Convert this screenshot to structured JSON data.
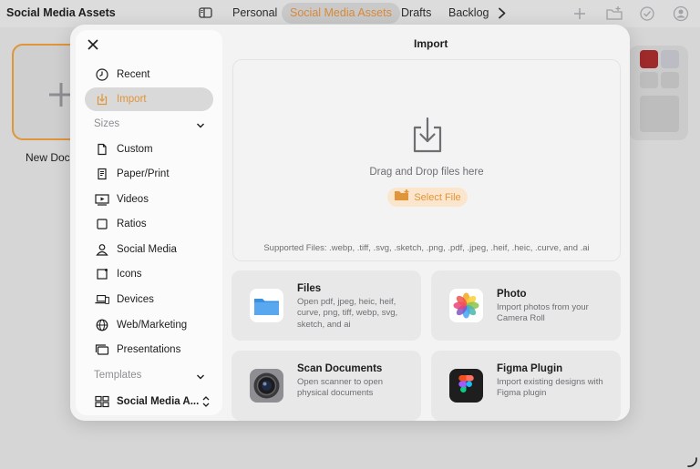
{
  "app": {
    "title": "Social Media Assets"
  },
  "tabs": [
    {
      "label": "Personal"
    },
    {
      "label": "Social Media Assets"
    },
    {
      "label": "Drafts"
    },
    {
      "label": "Backlog"
    }
  ],
  "toolbar": {
    "icons": [
      "sidebar-icon",
      "chevron-right-icon",
      "plus-icon",
      "folder-plus-icon",
      "checkmark-circle-icon",
      "account-icon"
    ]
  },
  "background": {
    "new_document_label": "New Docu"
  },
  "modal": {
    "title": "Import",
    "sidebar": {
      "items": [
        {
          "label": "Recent",
          "icon": "clock-icon"
        },
        {
          "label": "Import",
          "icon": "import-icon"
        }
      ],
      "sizes_header": "Sizes",
      "sizes": [
        {
          "label": "Custom",
          "icon": "document-icon"
        },
        {
          "label": "Paper/Print",
          "icon": "paper-icon"
        },
        {
          "label": "Videos",
          "icon": "video-icon"
        },
        {
          "label": "Ratios",
          "icon": "square-icon"
        },
        {
          "label": "Social Media",
          "icon": "person-icon"
        },
        {
          "label": "Icons",
          "icon": "icon-frame-icon"
        },
        {
          "label": "Devices",
          "icon": "devices-icon"
        },
        {
          "label": "Web/Marketing",
          "icon": "globe-icon"
        },
        {
          "label": "Presentations",
          "icon": "presentation-icon"
        }
      ],
      "templates_header": "Templates",
      "templates_selected": "Social Media A..."
    },
    "drop_zone": {
      "text": "Drag and Drop files here",
      "select_button": "Select File",
      "supported": "Supported Files: .webp, .tiff, .svg, .sketch, .png, .pdf, .jpeg, .heif, .heic, .curve, and .ai"
    },
    "options": [
      {
        "title": "Files",
        "description": "Open pdf, jpeg, heic, heif, curve, png, tiff, webp, svg, sketch, and ai"
      },
      {
        "title": "Photo",
        "description": "Import photos from your Camera Roll"
      },
      {
        "title": "Scan Documents",
        "description": "Open scanner to open physical documents"
      },
      {
        "title": "Figma Plugin",
        "description": "Import existing designs with Figma plugin"
      }
    ]
  },
  "colors": {
    "accent": "#e0953a",
    "accent_bg": "#fbe6cd",
    "secondary_text": "#6e6e73"
  }
}
